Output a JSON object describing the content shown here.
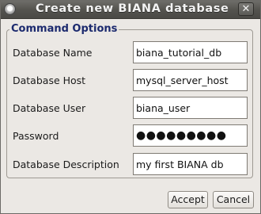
{
  "window": {
    "title": "Create new BIANA database",
    "close_glyph": "✕",
    "menu_icon": "window-menu-icon",
    "close_icon": "close-icon"
  },
  "group": {
    "legend": "Command Options"
  },
  "fields": [
    {
      "label": "Database Name",
      "value": "biana_tutorial_db"
    },
    {
      "label": "Database Host",
      "value": "mysql_server_host"
    },
    {
      "label": "Database User",
      "value": "biana_user"
    },
    {
      "label": "Password",
      "value": "●●●●●●●●●"
    },
    {
      "label": "Database Description",
      "value": "my first BIANA db"
    }
  ],
  "buttons": {
    "accept": "Accept",
    "cancel": "Cancel"
  },
  "colors": {
    "titlebar": "#55544f",
    "dialog_bg": "#ebe8e4",
    "legend_text": "#1c2a6e"
  }
}
